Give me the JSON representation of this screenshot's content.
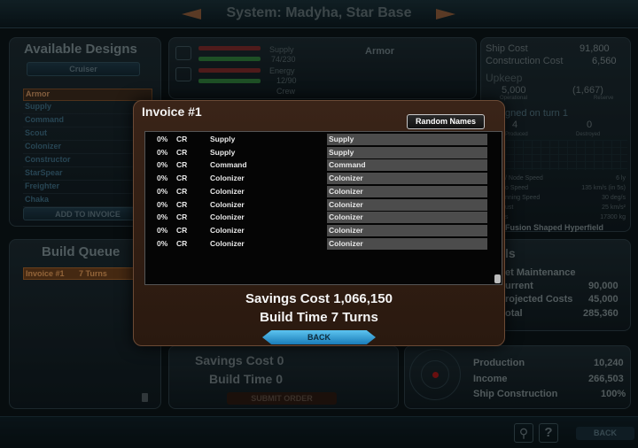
{
  "top": {
    "title": "System: Madyha, Star Base"
  },
  "designs": {
    "header": "Available Designs",
    "class_button": "Cruiser",
    "items": [
      "Armor",
      "Supply",
      "Command",
      "Scout",
      "Colonizer",
      "Constructor",
      "StarSpear",
      "Freighter",
      "Chaka"
    ],
    "add_button": "ADD TO INVOICE"
  },
  "queue": {
    "header": "Build Queue",
    "entries": [
      {
        "name": "Invoice #1",
        "time": "7 Turns"
      }
    ]
  },
  "modules": {
    "armor_label": "Armor",
    "rows": [
      {
        "label": "Supply",
        "value": "74/230"
      },
      {
        "label": "Energy",
        "value": "12/90"
      },
      {
        "label": "Crew",
        "value": ""
      }
    ]
  },
  "order": {
    "savings_label": "Savings Cost",
    "savings_value": "0",
    "time_label": "Build Time",
    "time_value": "0",
    "submit": "SUBMIT ORDER"
  },
  "ship": {
    "cost_label": "Ship Cost",
    "cost_value": "91,800",
    "construction_label": "Construction Cost",
    "construction_value": "6,560",
    "upkeep_label": "Upkeep",
    "operational_value": "5,000",
    "operational_label": "Operational",
    "reserve_value": "(1,667)",
    "reserve_label": "Reserve",
    "assigned_label": "gned on turn 1",
    "produced_value": "4",
    "produced_label": "Produced",
    "destroyed_value": "0",
    "destroyed_label": "Destroyed",
    "specs": [
      {
        "label": "/ Node Speed",
        "value": "6 ly"
      },
      {
        "label": "o Speed",
        "value": "135 km/s (in 5s)"
      },
      {
        "label": "nning Speed",
        "value": "30 deg/s"
      },
      {
        "label": "ust",
        "value": "25 km/s²"
      },
      {
        "label": "s",
        "value": "17300 kg"
      }
    ],
    "engine": "Fusion Shaped Hyperfield"
  },
  "totals": {
    "header_partial": "ls",
    "fleet_label": "et Maintenance",
    "current_label": "urrent",
    "current_value": "90,000",
    "projected_label": "rojected Costs",
    "projected_value": "45,000",
    "total_label": "otal",
    "total_value": "285,360"
  },
  "economy": {
    "production_label": "Production",
    "production_value": "10,240",
    "income_label": "Income",
    "income_value": "266,503",
    "ship_label": "Ship Construction",
    "ship_value": "100%"
  },
  "bottom": {
    "help": "?",
    "back": "BACK"
  },
  "invoice": {
    "title": "Invoice #1",
    "random_button": "Random Names",
    "rows": [
      {
        "pct": "0%",
        "cr": "CR",
        "type": "Supply",
        "name": "Supply"
      },
      {
        "pct": "0%",
        "cr": "CR",
        "type": "Supply",
        "name": "Supply"
      },
      {
        "pct": "0%",
        "cr": "CR",
        "type": "Command",
        "name": "Command"
      },
      {
        "pct": "0%",
        "cr": "CR",
        "type": "Colonizer",
        "name": "Colonizer"
      },
      {
        "pct": "0%",
        "cr": "CR",
        "type": "Colonizer",
        "name": "Colonizer"
      },
      {
        "pct": "0%",
        "cr": "CR",
        "type": "Colonizer",
        "name": "Colonizer"
      },
      {
        "pct": "0%",
        "cr": "CR",
        "type": "Colonizer",
        "name": "Colonizer"
      },
      {
        "pct": "0%",
        "cr": "CR",
        "type": "Colonizer",
        "name": "Colonizer"
      },
      {
        "pct": "0%",
        "cr": "CR",
        "type": "Colonizer",
        "name": "Colonizer"
      }
    ],
    "savings": "Savings Cost  1,066,150",
    "build_time": "Build Time  7 Turns",
    "back_button": "BACK"
  }
}
